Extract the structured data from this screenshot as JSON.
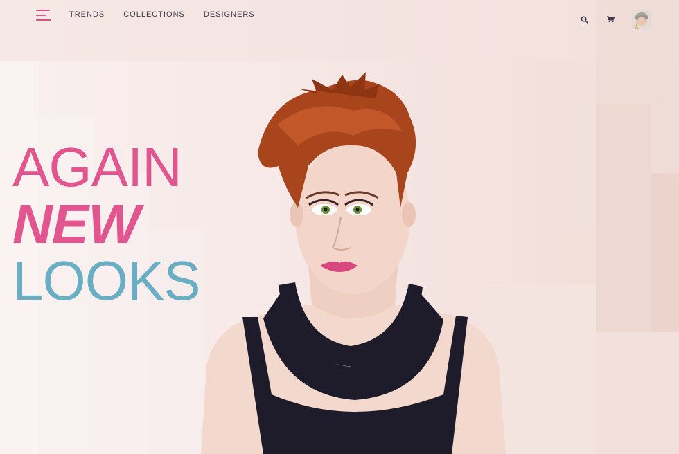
{
  "nav": {
    "links": [
      "TRENDS",
      "COLLECTIONS",
      "DESIGNERS"
    ]
  },
  "header": {
    "icons": [
      "hamburger-menu-icon",
      "search-icon",
      "cart-icon",
      "user-avatar"
    ]
  },
  "hero": {
    "line1": "AGAIN",
    "line2": "NEW",
    "line3": "LOOKS"
  },
  "colors": {
    "accent_pink": "#e2568f",
    "accent_blue": "#6aaec4",
    "nav_text": "#3d3a4c",
    "background": "#f7ecea"
  }
}
